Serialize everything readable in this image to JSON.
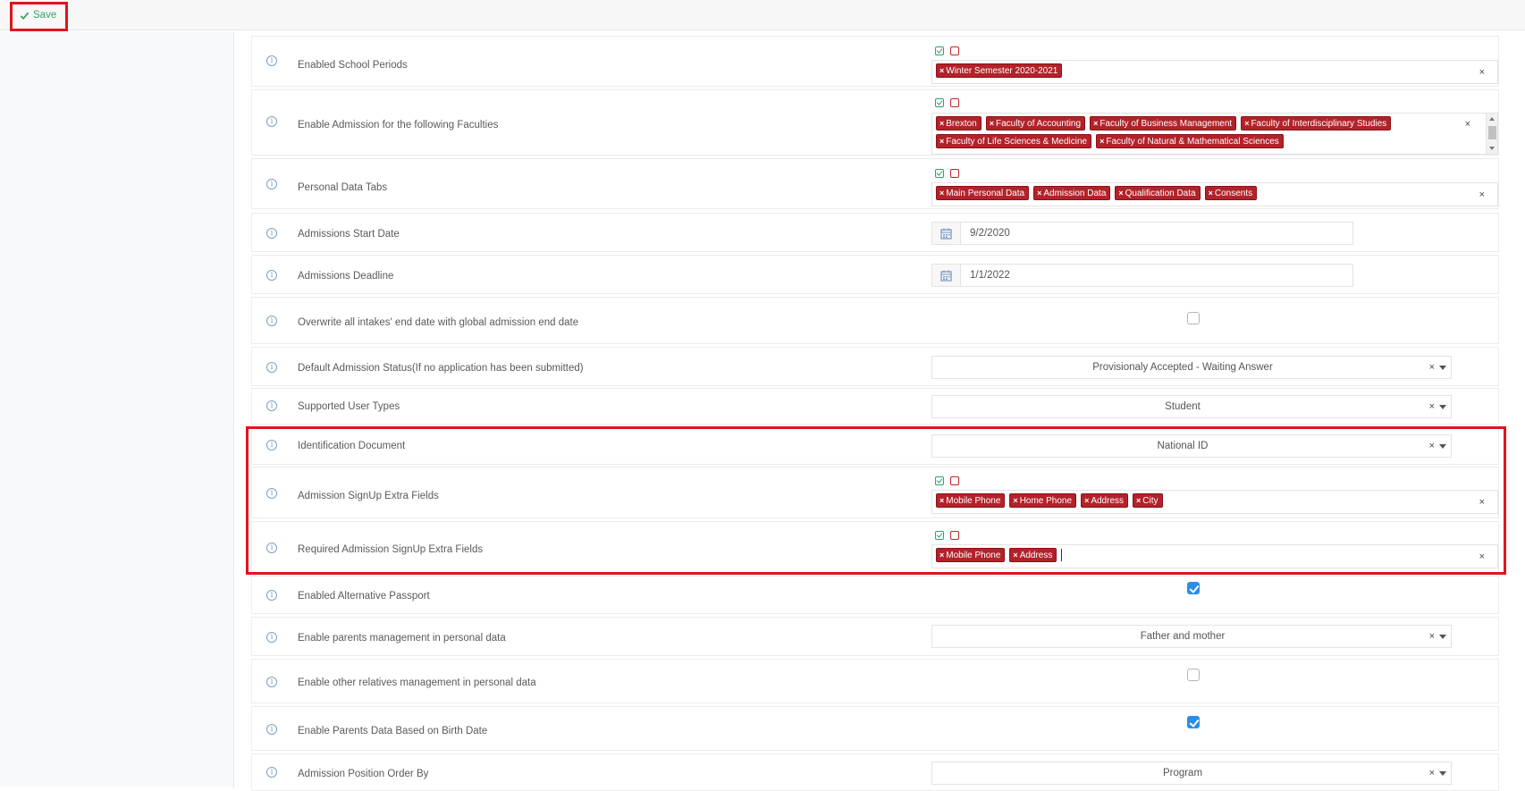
{
  "toolbar": {
    "save_label": "Save"
  },
  "rows": {
    "school_periods": {
      "label": "Enabled School Periods",
      "tags": [
        "Winter Semester 2020-2021"
      ]
    },
    "faculties": {
      "label": "Enable Admission for the following Faculties",
      "tags": [
        "Brexton",
        "Faculty of Accounting",
        "Faculty of Business Management",
        "Faculty of Interdisciplinary Studies",
        "Faculty of Life Sciences & Medicine",
        "Faculty of Natural & Mathematical Sciences"
      ]
    },
    "personal_tabs": {
      "label": "Personal Data Tabs",
      "tags": [
        "Main Personal Data",
        "Admission Data",
        "Qualification Data",
        "Consents"
      ]
    },
    "start_date": {
      "label": "Admissions Start Date",
      "value": "9/2/2020"
    },
    "deadline": {
      "label": "Admissions Deadline",
      "value": "1/1/2022"
    },
    "overwrite": {
      "label": "Overwrite all intakes' end date with global admission end date",
      "checked": false
    },
    "default_status": {
      "label": "Default Admission Status(If no application has been submitted)",
      "value": "Provisionaly Accepted - Waiting Answer"
    },
    "user_types": {
      "label": "Supported User Types",
      "value": "Student"
    },
    "id_document": {
      "label": "Identification Document",
      "value": "National ID"
    },
    "signup_extra": {
      "label": "Admission SignUp Extra Fields",
      "tags": [
        "Mobile Phone",
        "Home Phone",
        "Address",
        "City"
      ]
    },
    "required_extra": {
      "label": "Required Admission SignUp Extra Fields",
      "tags": [
        "Mobile Phone",
        "Address"
      ]
    },
    "alt_passport": {
      "label": "Enabled Alternative Passport",
      "checked": true
    },
    "parents_mgmt": {
      "label": "Enable parents management in personal data",
      "value": "Father and mother"
    },
    "relatives_mgmt": {
      "label": "Enable other relatives management in personal data",
      "checked": false
    },
    "parents_birth": {
      "label": "Enable Parents Data Based on Birth Date",
      "checked": true
    },
    "position_order": {
      "label": "Admission Position Order By",
      "value": "Program"
    }
  },
  "colors": {
    "accent_green": "#3aa56b",
    "tag_red": "#b3222a",
    "checkbox_blue": "#2d8ce6",
    "highlight_red": "#e0141e"
  }
}
